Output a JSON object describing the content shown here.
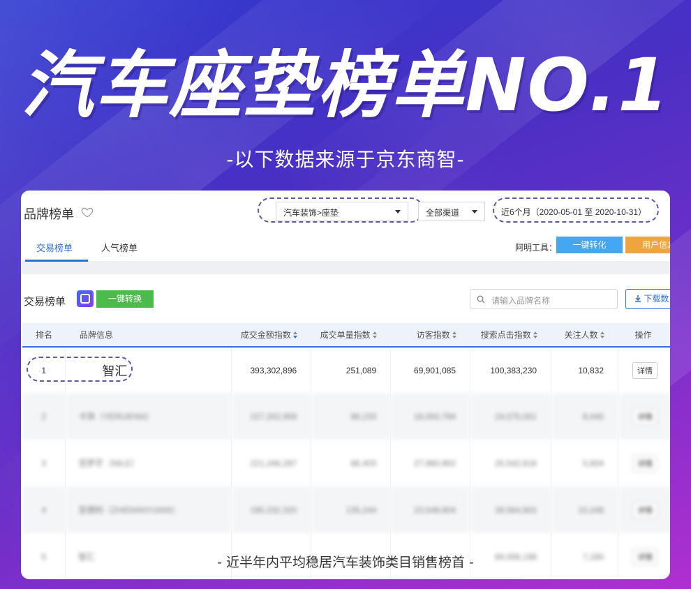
{
  "hero": {
    "title": "汽车座垫榜单NO.1",
    "subtitle": "-以下数据来源于京东商智-"
  },
  "topbar": {
    "title": "品牌榜单",
    "category_select": "汽车装饰>座垫",
    "channel_select": "全部渠道",
    "date_select": "近6个月（2020-05-01 至 2020-10-31）"
  },
  "tabs": {
    "trade": "交易榜单",
    "popularity": "人气榜单",
    "tools_label": "阿明工具：",
    "convert_btn": "一键转化",
    "user_btn": "用户信息"
  },
  "section": {
    "title": "交易榜单",
    "convert_btn": "一键转换",
    "search_placeholder": "请输入品牌名称",
    "download_btn": "下载数"
  },
  "table": {
    "headers": {
      "rank": "排名",
      "brand": "品牌信息",
      "amount": "成交金额指数",
      "orders": "成交单量指数",
      "visitors": "访客指数",
      "search_clicks": "搜索点击指数",
      "followers": "关注人数",
      "action": "操作"
    },
    "rows": [
      {
        "rank": "1",
        "brand": "智汇",
        "amount": "393,302,896",
        "orders": "251,089",
        "visitors": "69,901,085",
        "search": "100,383,230",
        "followers": "10,832",
        "action": "详情"
      },
      {
        "rank": "2",
        "brand": "卡饰（YERUIFAN）",
        "amount": "227,202,959",
        "orders": "86,233",
        "visitors": "18,050,794",
        "search": "24,075,051",
        "followers": "8,440",
        "action": "详情"
      },
      {
        "rank": "3",
        "brand": "范罗芒（NILE）",
        "amount": "221,246,287",
        "orders": "86,403",
        "visitors": "27,980,902",
        "search": "25,542,616",
        "followers": "5,604",
        "action": "详情"
      },
      {
        "rank": "4",
        "brand": "亚德利（ZHIDIANYIJIAN）",
        "amount": "195,232,320",
        "orders": "135,244",
        "visitors": "23,548,804",
        "search": "39,564,802",
        "followers": "10,248",
        "action": "详情"
      },
      {
        "rank": "5",
        "brand": "智汇",
        "amount": "",
        "orders": "",
        "visitors": "",
        "search": "84,056,198",
        "followers": "7,180",
        "action": "详情"
      }
    ]
  },
  "caption": "- 近半年内平均稳居汽车装饰类目销售榜首 -"
}
